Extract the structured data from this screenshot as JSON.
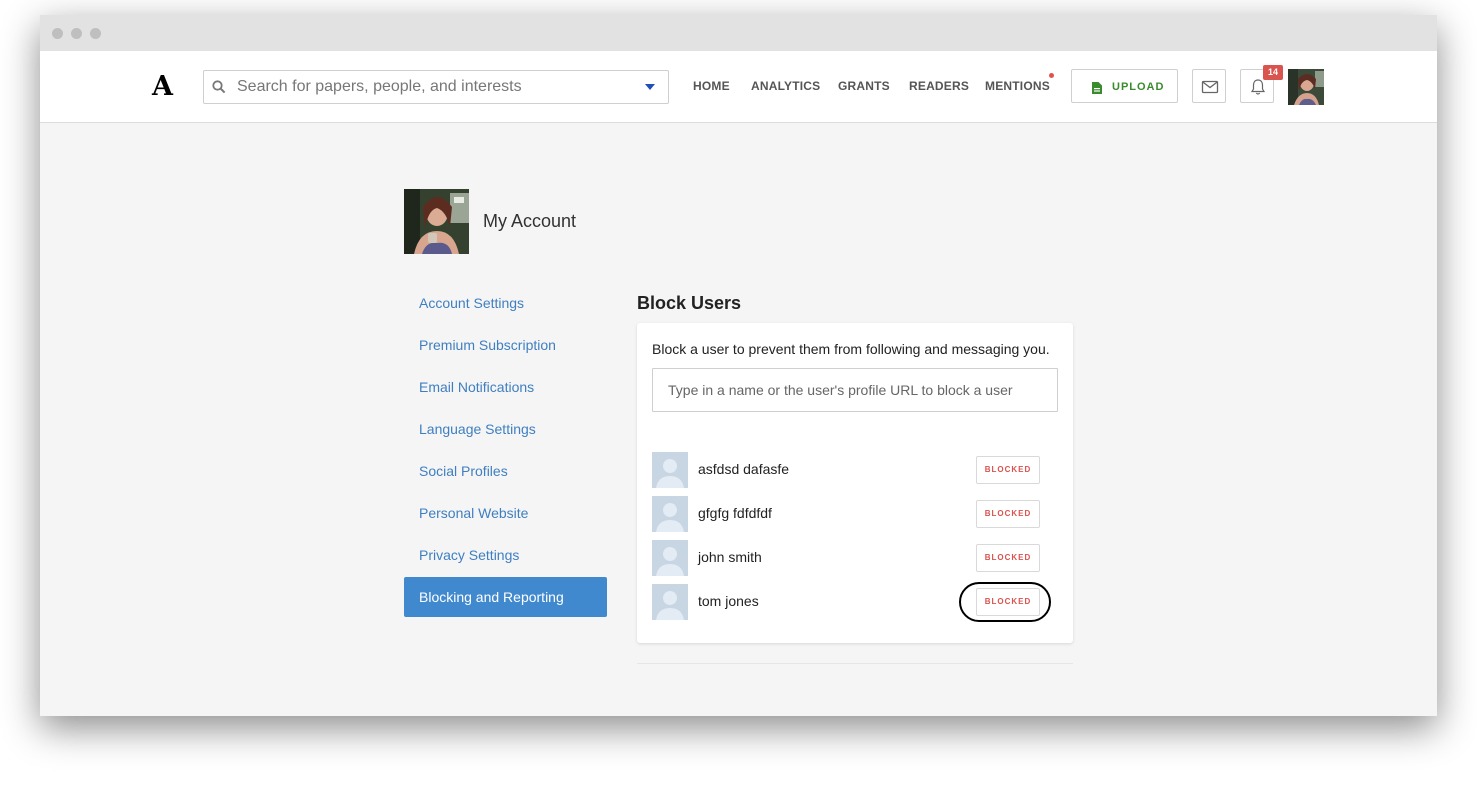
{
  "navbar": {
    "logo": "A",
    "search_placeholder": "Search for papers, people, and interests",
    "links": [
      "HOME",
      "ANALYTICS",
      "GRANTS",
      "READERS",
      "MENTIONS"
    ],
    "upload_label": "UPLOAD",
    "notification_count": "14",
    "icons": {
      "search": "search-icon",
      "dropdown": "caret-down-icon",
      "upload": "file-icon",
      "messages": "envelope-icon",
      "notifications": "bell-icon"
    }
  },
  "account": {
    "title": "My Account"
  },
  "sidebar": {
    "items": [
      {
        "label": "Account Settings",
        "active": false
      },
      {
        "label": "Premium Subscription",
        "active": false
      },
      {
        "label": "Email Notifications",
        "active": false
      },
      {
        "label": "Language Settings",
        "active": false
      },
      {
        "label": "Social Profiles",
        "active": false
      },
      {
        "label": "Personal Website",
        "active": false
      },
      {
        "label": "Privacy Settings",
        "active": false
      },
      {
        "label": "Blocking and Reporting",
        "active": true
      }
    ]
  },
  "block_users": {
    "title": "Block Users",
    "description": "Block a user to prevent them from following and messaging you.",
    "input_placeholder": "Type in a name or the user's profile URL to block a user",
    "users": [
      {
        "name": "asfdsd dafasfe",
        "status": "BLOCKED"
      },
      {
        "name": "gfgfg fdfdfdf",
        "status": "BLOCKED"
      },
      {
        "name": "john smith",
        "status": "BLOCKED"
      },
      {
        "name": "tom jones",
        "status": "BLOCKED"
      }
    ]
  },
  "colors": {
    "link": "#3f7fc1",
    "active_nav": "#4189ce",
    "blocked": "#d9534f",
    "upload": "#3a8a2e",
    "badge": "#d9534f"
  }
}
